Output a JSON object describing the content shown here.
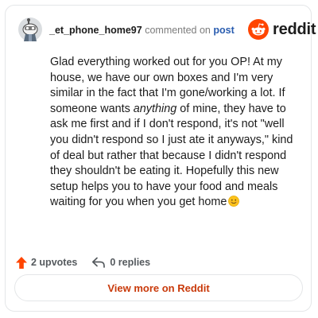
{
  "header": {
    "username": "_et_phone_home97",
    "action_text": "commented on",
    "post_link_text": "post",
    "logo_word": "reddit"
  },
  "comment": {
    "text_part1": "Glad everything worked out for you OP! At my house, we have our own boxes and I'm very similar in the fact that I'm gone/working a lot. If someone wants ",
    "text_italic": "anything",
    "text_part2": " of mine, they have to ask me first and if I don't respond, it's not \"well you didn't respond so I just ate it anyways,\" kind of deal but rather that because I didn't respond they shouldn't be eating it. Hopefully this new setup helps you to have your food and meals waiting for you when you get home",
    "emoji": "smiling-face-emoji"
  },
  "footer": {
    "upvotes_label": "2 upvotes",
    "replies_label": "0 replies"
  },
  "view_more_label": "View more on Reddit",
  "colors": {
    "brand_orange": "#ff4500",
    "upvote_orange": "#ff4500",
    "link_blue": "#2a5db0",
    "view_more_text": "#c93a0b",
    "border": "#e4e6e8"
  },
  "icons": {
    "avatar": "snoo-avatar-icon",
    "logo": "reddit-snoo-icon",
    "upvote": "upvote-arrow-icon",
    "reply": "reply-arrow-icon"
  }
}
